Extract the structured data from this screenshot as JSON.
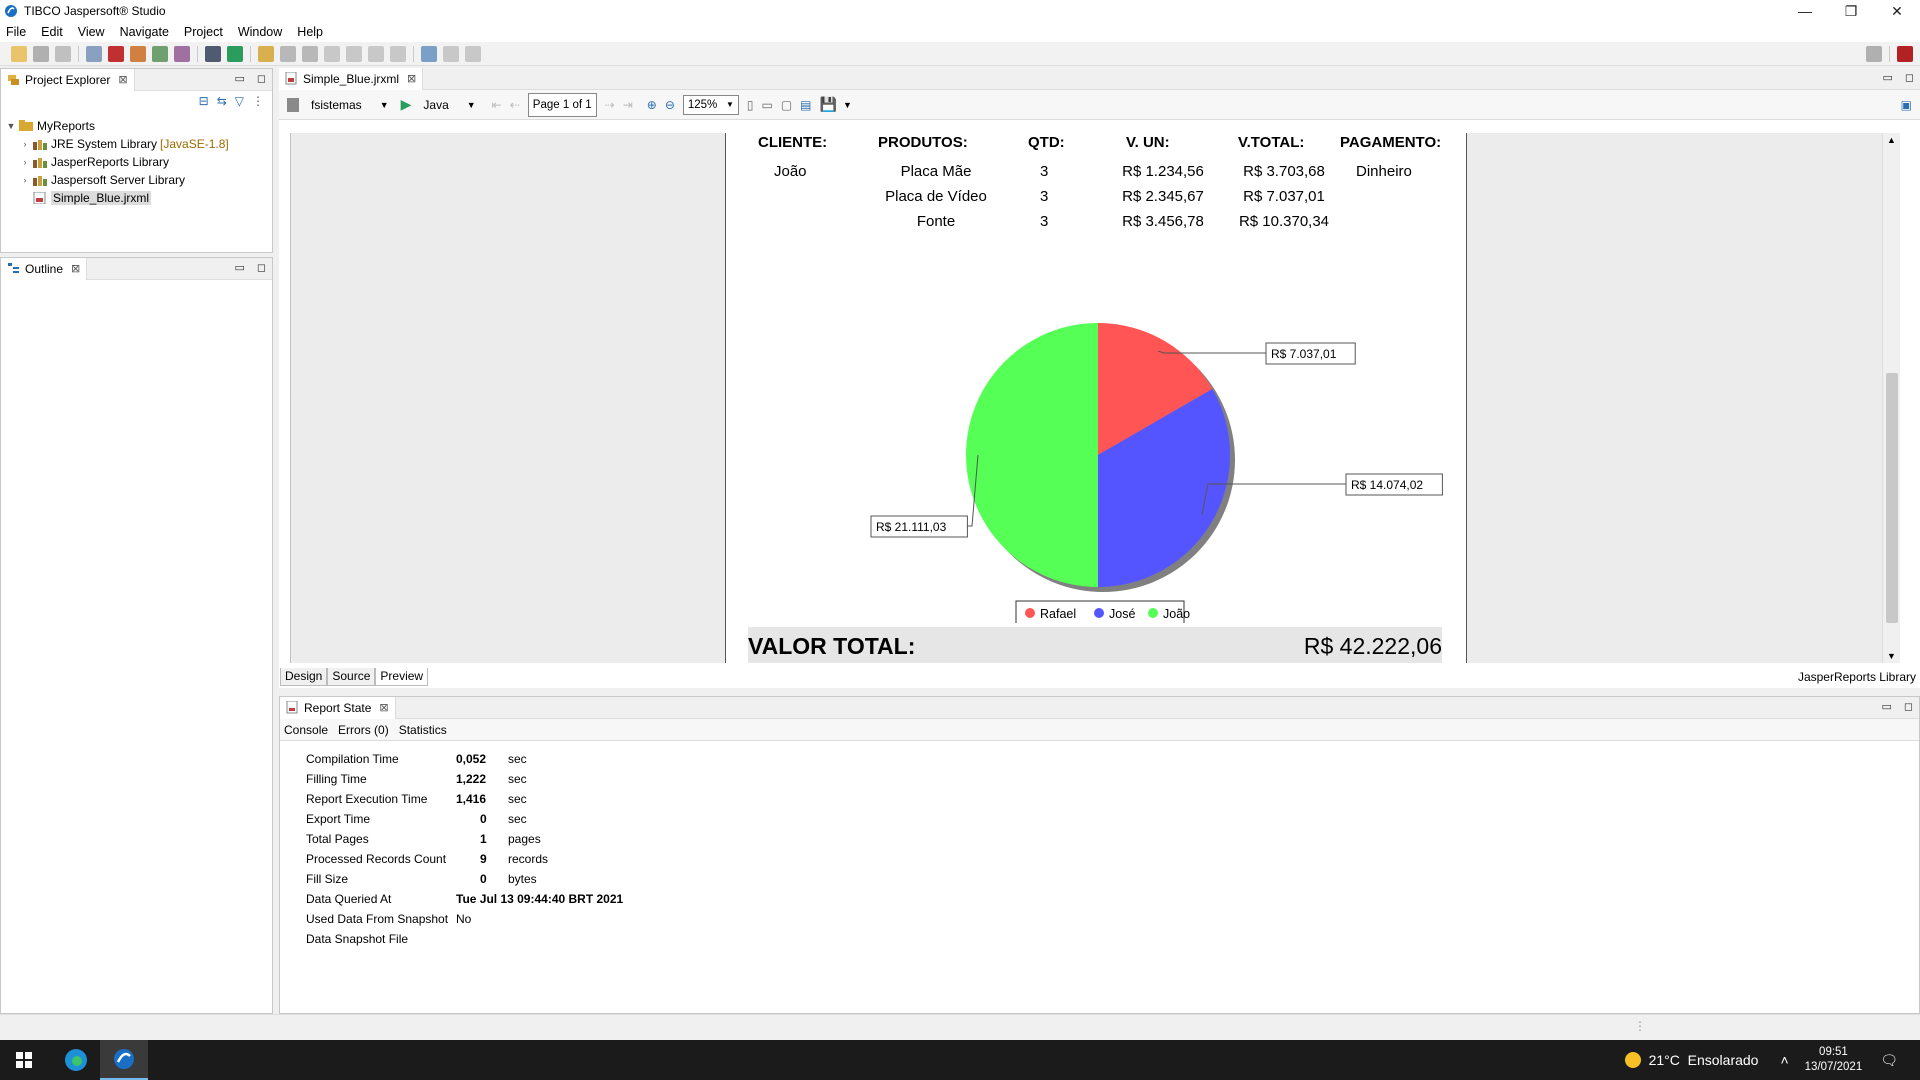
{
  "window": {
    "title": "TIBCO Jaspersoft® Studio",
    "controls": {
      "minimize": "—",
      "restore": "❐",
      "close": "✕"
    }
  },
  "menu": [
    "File",
    "Edit",
    "View",
    "Navigate",
    "Project",
    "Window",
    "Help"
  ],
  "project_explorer": {
    "tab": "Project Explorer",
    "root": "MyReports",
    "items": [
      {
        "label": "JRE System Library",
        "decoration": "[JavaSE-1.8]"
      },
      {
        "label": "JasperReports Library",
        "decoration": ""
      },
      {
        "label": "Jaspersoft Server Library",
        "decoration": ""
      },
      {
        "label": "Simple_Blue.jrxml",
        "decoration": ""
      }
    ]
  },
  "outline": {
    "tab": "Outline"
  },
  "editor": {
    "tab": "Simple_Blue.jrxml",
    "adapter": "fsistemas",
    "language": "Java",
    "page": "Page 1 of 1",
    "zoom": "125%",
    "bottom_tabs": [
      "Design",
      "Source",
      "Preview"
    ],
    "library_label": "JasperReports Library"
  },
  "report": {
    "headers": [
      "CLIENTE:",
      "PRODUTOS:",
      "QTD:",
      "V. UN:",
      "V.TOTAL:",
      "PAGAMENTO:"
    ],
    "rows": [
      {
        "cliente": "João",
        "produto": "Placa Mãe",
        "qtd": "3",
        "vun": "R$ 1.234,56",
        "vtotal": "R$ 3.703,68",
        "pagamento": "Dinheiro"
      },
      {
        "cliente": "",
        "produto": "Placa de Vídeo",
        "qtd": "3",
        "vun": "R$ 2.345,67",
        "vtotal": "R$ 7.037,01",
        "pagamento": ""
      },
      {
        "cliente": "",
        "produto": "Fonte",
        "qtd": "3",
        "vun": "R$ 3.456,78",
        "vtotal": "R$ 10.370,34",
        "pagamento": ""
      }
    ],
    "total_label": "VALOR TOTAL:",
    "total_value": "R$ 42.222,06"
  },
  "chart_data": {
    "type": "pie",
    "categories": [
      "Rafael",
      "José",
      "João"
    ],
    "values": [
      7037.01,
      14074.02,
      21111.03
    ],
    "labels": [
      "R$ 7.037,01",
      "R$ 14.074,02",
      "R$ 21.111,03"
    ],
    "colors": [
      "#ff5555",
      "#5555ff",
      "#55ff55"
    ],
    "legend": "bottom"
  },
  "report_state": {
    "tab": "Report State",
    "subtabs": [
      "Console",
      "Errors (0)",
      "Statistics"
    ],
    "stats": [
      {
        "key": "Compilation Time",
        "value": "0,052",
        "unit": "sec"
      },
      {
        "key": "Filling Time",
        "value": "1,222",
        "unit": "sec"
      },
      {
        "key": "Report Execution Time",
        "value": "1,416",
        "unit": "sec"
      },
      {
        "key": "Export Time",
        "value": "0",
        "unit": "sec"
      },
      {
        "key": "Total Pages",
        "value": "1",
        "unit": "pages"
      },
      {
        "key": "Processed Records Count",
        "value": "9",
        "unit": "records"
      },
      {
        "key": "Fill Size",
        "value": "0",
        "unit": "bytes"
      },
      {
        "key": "Data Queried At",
        "value": "Tue Jul 13 09:44:40 BRT 2021",
        "unit": ""
      },
      {
        "key": "Used Data From Snapshot",
        "value": "No",
        "unit": ""
      },
      {
        "key": "Data Snapshot File",
        "value": "",
        "unit": ""
      }
    ]
  },
  "taskbar": {
    "weather": "21°C  Ensolarado",
    "time": "09:51",
    "date": "13/07/2021"
  }
}
